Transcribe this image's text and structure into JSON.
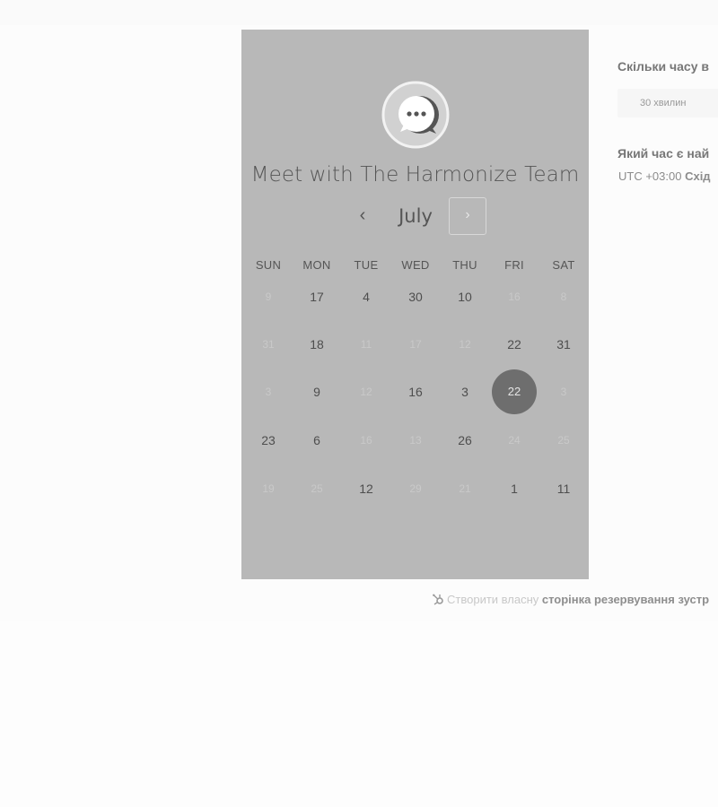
{
  "meeting": {
    "title": "Meet with The Harmonize Team",
    "logo_icon": "chat-bubble-icon"
  },
  "calendar": {
    "month": "July",
    "prev_label": "‹",
    "next_label": "›",
    "weekdays": [
      "SUN",
      "MON",
      "TUE",
      "WED",
      "THU",
      "FRI",
      "SAT"
    ],
    "weeks": [
      [
        {
          "d": "9",
          "dim": true
        },
        {
          "d": "17",
          "dim": false
        },
        {
          "d": "4",
          "dim": false
        },
        {
          "d": "30",
          "dim": false
        },
        {
          "d": "10",
          "dim": false
        },
        {
          "d": "16",
          "dim": true
        },
        {
          "d": "8",
          "dim": true
        }
      ],
      [
        {
          "d": "31",
          "dim": true
        },
        {
          "d": "18",
          "dim": false
        },
        {
          "d": "11",
          "dim": true
        },
        {
          "d": "17",
          "dim": true
        },
        {
          "d": "12",
          "dim": true
        },
        {
          "d": "22",
          "dim": false
        },
        {
          "d": "31",
          "dim": false
        }
      ],
      [
        {
          "d": "3",
          "dim": true
        },
        {
          "d": "9",
          "dim": false
        },
        {
          "d": "12",
          "dim": true
        },
        {
          "d": "16",
          "dim": false
        },
        {
          "d": "3",
          "dim": false
        },
        {
          "d": "22",
          "dim": false,
          "selected": true
        },
        {
          "d": "3",
          "dim": true
        }
      ],
      [
        {
          "d": "23",
          "dim": false
        },
        {
          "d": "6",
          "dim": false
        },
        {
          "d": "16",
          "dim": true
        },
        {
          "d": "13",
          "dim": true
        },
        {
          "d": "26",
          "dim": false
        },
        {
          "d": "24",
          "dim": true
        },
        {
          "d": "25",
          "dim": true
        }
      ],
      [
        {
          "d": "19",
          "dim": true
        },
        {
          "d": "25",
          "dim": true
        },
        {
          "d": "12",
          "dim": false
        },
        {
          "d": "29",
          "dim": true
        },
        {
          "d": "21",
          "dim": true
        },
        {
          "d": "1",
          "dim": false
        },
        {
          "d": "11",
          "dim": false
        }
      ]
    ]
  },
  "side": {
    "duration_heading": "Скільки часу в",
    "duration_option": "30 хвилин",
    "time_heading": "Який час є най",
    "timezone_prefix": "UTC +03:00 ",
    "timezone_name": "Схід"
  },
  "footer": {
    "text": "Створити власну ",
    "link": "сторінка резервування зустр",
    "icon": "hubspot-sprocket-icon"
  },
  "colors": {
    "panel": "#b8b8b8",
    "selected_day": "#6e6e6e"
  }
}
